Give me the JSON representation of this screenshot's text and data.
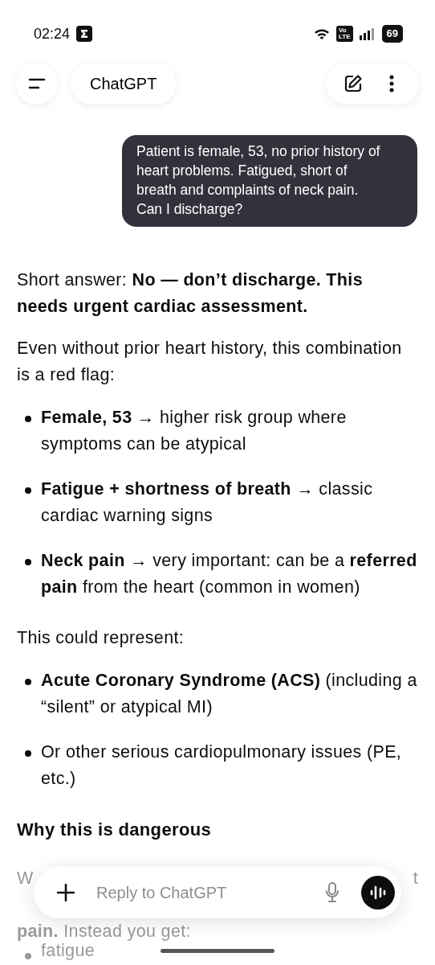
{
  "status_bar": {
    "time": "02:24",
    "network_badge": [
      "Vo",
      "LTE"
    ],
    "battery": "69"
  },
  "header": {
    "title": "ChatGPT"
  },
  "user_message": {
    "text": "Patient is female, 53, no prior history of heart problems. Fatigued, short of breath and complaints of neck pain. Can I discharge?"
  },
  "response": [
    {
      "kind": "paragraph",
      "text": "Short answer: **No — don’t discharge. This needs urgent cardiac assessment.**"
    },
    {
      "kind": "paragraph",
      "text": "Even without prior heart history, this combination is a red flag:"
    },
    {
      "kind": "bullets",
      "items": [
        "**Female, 53** → higher risk group where symptoms can be atypical",
        "**Fatigue + shortness of breath** → classic cardiac warning signs",
        "**Neck pain** → very important: can be a **referred pain** from the heart (common in women)"
      ]
    },
    {
      "kind": "paragraph",
      "text": "This could represent:"
    },
    {
      "kind": "bullets",
      "items": [
        "**Acute Coronary Syndrome (ACS)** (including a “silent” or atypical MI)",
        "Or other serious cardiopulmonary issues (PE, etc.)"
      ]
    },
    {
      "kind": "heading",
      "text": "Why this is dangerous"
    },
    {
      "kind": "covered",
      "left": "W",
      "right": "t"
    },
    {
      "kind": "faded",
      "text": "**pain.** Instead you get:"
    },
    {
      "kind": "faded_bullet",
      "text": "fatigue"
    }
  ],
  "composer": {
    "placeholder": "Reply to ChatGPT"
  }
}
